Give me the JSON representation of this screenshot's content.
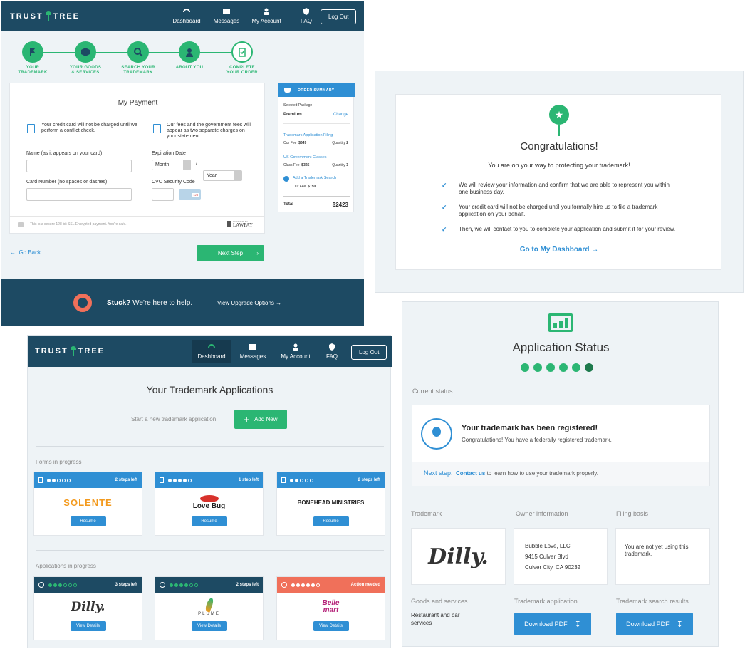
{
  "colors": {
    "navy": "#1d4a63",
    "green": "#2bb673",
    "blue": "#2f8fd4",
    "salmon": "#f0705a"
  },
  "brand": "TRUST",
  "brand2": "TREE",
  "nav": {
    "dashboard": "Dashboard",
    "messages": "Messages",
    "account": "My Account",
    "faq": "FAQ",
    "logout": "Log Out"
  },
  "steps": [
    {
      "l1": "YOUR",
      "l2": "TRADEMARK"
    },
    {
      "l1": "YOUR GOODS",
      "l2": "& SERVICES"
    },
    {
      "l1": "SEARCH YOUR",
      "l2": "TRADEMARK"
    },
    {
      "l1": "ABOUT YOU",
      "l2": ""
    },
    {
      "l1": "COMPLETE",
      "l2": "YOUR ORDER"
    }
  ],
  "payment": {
    "title": "My Payment",
    "note1": "Your credit card will not be charged until we perform a conflict check.",
    "note2": "Our fees and the government fees will appear as two separate charges on your statement.",
    "name_label": "Name (as it appears on your card)",
    "card_label": "Card Number (no spaces or dashes)",
    "exp_label": "Expiration Date",
    "month": "Month",
    "year": "Year",
    "slash": "/",
    "cvc_label": "CVC Security Code",
    "cvc_card": "123",
    "secure": "This is a secure 128-bit SSL Encrypted payment. You're safe.",
    "lawpay_small": "PAYMENTS BY",
    "lawpay": "LAWPAY",
    "back": "Go Back",
    "next": "Next Step"
  },
  "order": {
    "header": "ORDER SUMMARY",
    "selected": "Selected Package",
    "package": "Premium",
    "change": "Change",
    "item1": "Trademark Application Filing",
    "our_fee": "Our Fee",
    "fee1": "$649",
    "qty_label": "Quantity",
    "qty1": "2",
    "item2": "US Government Classes",
    "class_fee": "Class Fee",
    "fee2": "$325",
    "qty2": "3",
    "item3": "Add a Trademark Search",
    "fee3": "$150",
    "total_label": "Total",
    "total": "$2423"
  },
  "stuck": {
    "bold": "Stuck?",
    "text": "We're here to help.",
    "upgrade": "View Upgrade Options"
  },
  "congrats": {
    "title": "Congratulations!",
    "sub": "You are on your way to protecting your trademark!",
    "b1": "We will review your information and confirm that we are able to represent you within one business day.",
    "b2": "Your credit card will not be charged until you formally hire us to file a trademark application on your behalf.",
    "b3": "Then, we will contact to you to complete your application and submit it for your review.",
    "link": "Go to My Dashboard"
  },
  "dash": {
    "title": "Your Trademark Applications",
    "start": "Start a new trademark application",
    "add": "Add New",
    "forms": "Forms in progress",
    "apps": "Applications in progress",
    "resume": "Resume",
    "details": "View Details",
    "t1": {
      "steps": "2 steps left",
      "name": "SOLENTE"
    },
    "t2": {
      "steps": "1 step left",
      "name": "Love Bug"
    },
    "t3": {
      "steps": "2 steps left",
      "name": "BONEHEAD MINISTRIES"
    },
    "t4": {
      "steps": "3 steps left",
      "name": "Dilly."
    },
    "t5": {
      "steps": "2 steps left",
      "name": "PLUME"
    },
    "t6": {
      "steps": "Action needed",
      "name": "Belle mart"
    }
  },
  "status": {
    "title": "Application Status",
    "current": "Current status",
    "reg_title": "Your trademark has been registered!",
    "reg_sub": "Congratulations! You have a federally registered trademark.",
    "next_label": "Next step:",
    "contact": "Contact us",
    "next_text": "to learn how to use your trademark properly.",
    "trademark": "Trademark",
    "owner": "Owner information",
    "basis": "Filing basis",
    "mark": "Dilly.",
    "owner1": "Bubble Love, LLC",
    "owner2": "9415 Culver Blvd",
    "owner3": "Culver City, CA 90232",
    "basis_text": "You are not yet using this trademark.",
    "goods": "Goods and services",
    "goods_text": "Restaurant and bar services",
    "app": "Trademark application",
    "search": "Trademark search results",
    "download": "Download PDF"
  }
}
